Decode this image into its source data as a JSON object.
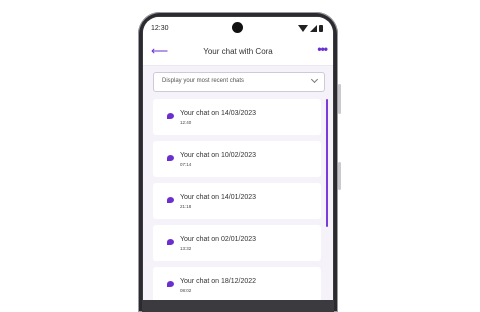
{
  "status_bar": {
    "time": "12:30"
  },
  "header": {
    "title": "Your chat with Cora"
  },
  "filter": {
    "label": "Display your most recent chats"
  },
  "chats": [
    {
      "title": "Your chat on 14/03/2023",
      "time": "12:40"
    },
    {
      "title": "Your chat on 10/02/2023",
      "time": "07:14"
    },
    {
      "title": "Your chat on 14/01/2023",
      "time": "21:18"
    },
    {
      "title": "Your chat on 02/01/2023",
      "time": "13:32"
    },
    {
      "title": "Your chat on 18/12/2022",
      "time": "08:02"
    }
  ],
  "colors": {
    "accent": "#6b2fd0",
    "background": "#f5f3f9"
  }
}
